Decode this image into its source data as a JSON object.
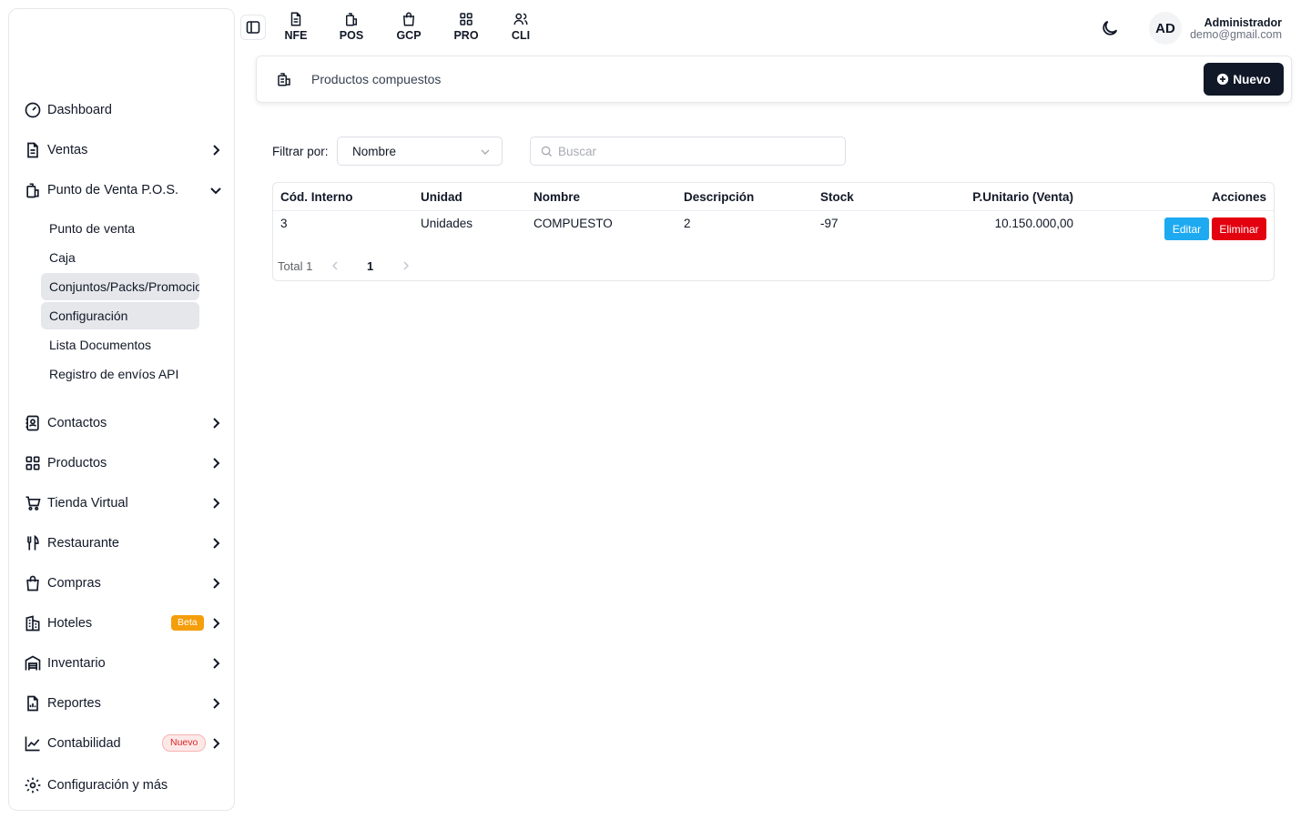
{
  "topbar": {
    "links": [
      {
        "label": "NFE",
        "icon": "file-text-icon"
      },
      {
        "label": "POS",
        "icon": "receipt-icon"
      },
      {
        "label": "GCP",
        "icon": "shopping-bag-icon"
      },
      {
        "label": "PRO",
        "icon": "grid-icon"
      },
      {
        "label": "CLI",
        "icon": "users-icon"
      }
    ],
    "user": {
      "initials": "AD",
      "name": "Administrador",
      "email": "demo@gmail.com"
    }
  },
  "sidebar": {
    "items": [
      {
        "label": "Dashboard"
      },
      {
        "label": "Ventas"
      },
      {
        "label": "Punto de Venta P.O.S."
      },
      {
        "label": "Contactos"
      },
      {
        "label": "Productos"
      },
      {
        "label": "Tienda Virtual"
      },
      {
        "label": "Restaurante"
      },
      {
        "label": "Compras"
      },
      {
        "label": "Hoteles",
        "badge": "Beta"
      },
      {
        "label": "Inventario"
      },
      {
        "label": "Reportes"
      },
      {
        "label": "Contabilidad",
        "badge": "Nuevo"
      },
      {
        "label": "Configuración y más"
      }
    ],
    "subitems": [
      {
        "label": "Punto de venta"
      },
      {
        "label": "Caja"
      },
      {
        "label": "Conjuntos/Packs/Promociones"
      },
      {
        "label": "Configuración"
      },
      {
        "label": "Lista Documentos"
      },
      {
        "label": "Registro de envíos API"
      }
    ]
  },
  "page": {
    "title": "Productos compuestos",
    "new_button": "Nuevo",
    "filter_label": "Filtrar por:",
    "filter_value": "Nombre",
    "search_placeholder": "Buscar"
  },
  "table": {
    "columns": [
      "Cód. Interno",
      "Unidad",
      "Nombre",
      "Descripción",
      "Stock",
      "P.Unitario (Venta)",
      "Acciones"
    ],
    "rows": [
      {
        "code": "3",
        "unit": "Unidades",
        "name": "COMPUESTO",
        "description": "2",
        "stock": "-97",
        "price": "10.150.000,00"
      }
    ],
    "edit_label": "Editar",
    "delete_label": "Eliminar"
  },
  "pagination": {
    "total": "Total 1",
    "current": "1"
  },
  "colors": {
    "primary": "#111827",
    "edit": "#1eaaf1",
    "delete": "#e3000f",
    "beta": "#f59e0b"
  }
}
